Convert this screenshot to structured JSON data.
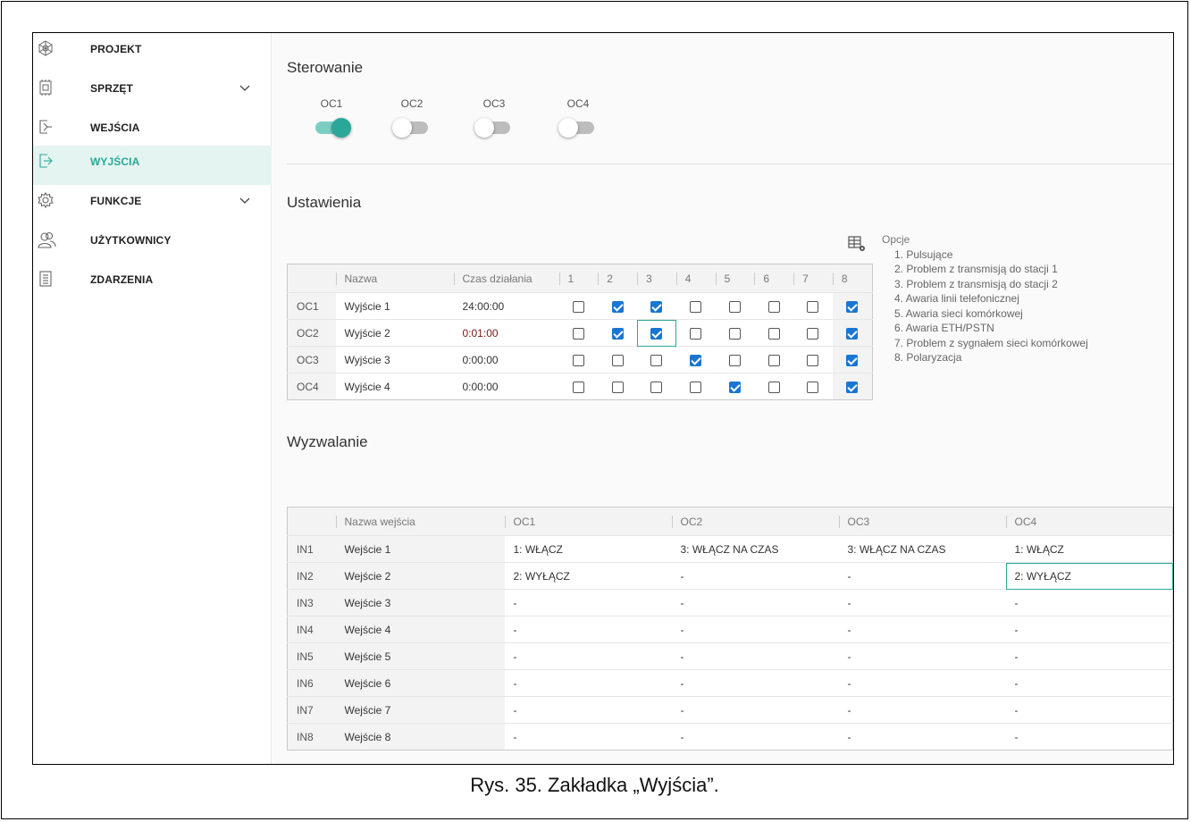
{
  "sidebar": {
    "items": [
      {
        "label": "PROJEKT",
        "icon": "project-icon"
      },
      {
        "label": "SPRZĘT",
        "icon": "hardware-icon",
        "expandable": true
      },
      {
        "label": "WEJŚCIA",
        "icon": "inputs-icon"
      },
      {
        "label": "WYJŚCIA",
        "icon": "outputs-icon",
        "active": true
      },
      {
        "label": "FUNKCJE",
        "icon": "gear-icon",
        "expandable": true
      },
      {
        "label": "UŻYTKOWNICY",
        "icon": "users-icon"
      },
      {
        "label": "ZDARZENIA",
        "icon": "events-icon"
      }
    ]
  },
  "control": {
    "title": "Sterowanie",
    "toggles": [
      {
        "label": "OC1",
        "on": true
      },
      {
        "label": "OC2",
        "on": false
      },
      {
        "label": "OC3",
        "on": false
      },
      {
        "label": "OC4",
        "on": false
      }
    ]
  },
  "settings": {
    "title": "Ustawienia",
    "headers": {
      "name": "Nazwa",
      "time": "Czas działania",
      "options": [
        "1",
        "2",
        "3",
        "4",
        "5",
        "6",
        "7",
        "8"
      ]
    },
    "rows": [
      {
        "id": "OC1",
        "name": "Wyjście 1",
        "time": "24:00:00",
        "checks": [
          false,
          true,
          true,
          false,
          false,
          false,
          false,
          true
        ]
      },
      {
        "id": "OC2",
        "name": "Wyjście 2",
        "time": "0:01:00",
        "checks": [
          false,
          true,
          true,
          false,
          false,
          false,
          false,
          true
        ]
      },
      {
        "id": "OC3",
        "name": "Wyjście 3",
        "time": "0:00:00",
        "checks": [
          false,
          false,
          false,
          true,
          false,
          false,
          false,
          true
        ]
      },
      {
        "id": "OC4",
        "name": "Wyjście 4",
        "time": "0:00:00",
        "checks": [
          false,
          false,
          false,
          false,
          true,
          false,
          false,
          true
        ]
      }
    ],
    "options_legend": {
      "title": "Opcje",
      "items": [
        "1. Pulsujące",
        "2. Problem z transmisją do stacji 1",
        "3. Problem z transmisją do stacji 2",
        "4. Awaria linii telefonicznej",
        "5. Awaria sieci komórkowej",
        "6. Awaria ETH/PSTN",
        "7. Problem z sygnałem sieci komórkowej",
        "8. Polaryzacja"
      ]
    }
  },
  "trigger": {
    "title": "Wyzwalanie",
    "headers": [
      "Nazwa wejścia",
      "OC1",
      "OC2",
      "OC3",
      "OC4"
    ],
    "rows": [
      {
        "id": "IN1",
        "name": "Wejście 1",
        "values": [
          "1: WŁĄCZ",
          "3: WŁĄCZ NA CZAS",
          "3: WŁĄCZ NA CZAS",
          "1: WŁĄCZ"
        ]
      },
      {
        "id": "IN2",
        "name": "Wejście 2",
        "values": [
          "2: WYŁĄCZ",
          "-",
          "-",
          "2: WYŁĄCZ"
        ]
      },
      {
        "id": "IN3",
        "name": "Wejście 3",
        "values": [
          "-",
          "-",
          "-",
          "-"
        ]
      },
      {
        "id": "IN4",
        "name": "Wejście 4",
        "values": [
          "-",
          "-",
          "-",
          "-"
        ]
      },
      {
        "id": "IN5",
        "name": "Wejście 5",
        "values": [
          "-",
          "-",
          "-",
          "-"
        ]
      },
      {
        "id": "IN6",
        "name": "Wejście 6",
        "values": [
          "-",
          "-",
          "-",
          "-"
        ]
      },
      {
        "id": "IN7",
        "name": "Wejście 7",
        "values": [
          "-",
          "-",
          "-",
          "-"
        ]
      },
      {
        "id": "IN8",
        "name": "Wejście 8",
        "values": [
          "-",
          "-",
          "-",
          "-"
        ]
      }
    ]
  },
  "caption": "Rys. 35. Zakładka „Wyjścia”.",
  "colors": {
    "accent": "#2aa798",
    "checkbox": "#1976d2",
    "active_bg": "#e3f4f1"
  }
}
